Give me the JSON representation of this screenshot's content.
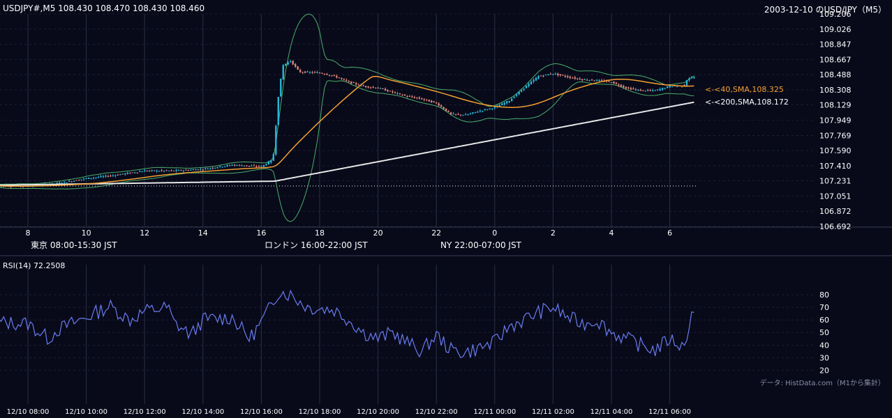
{
  "header": {
    "symbol_info": "USDJPY#,M5 108.430 108.470 108.430 108.460",
    "title": "2003-12-10 のUSD/JPY（M5）"
  },
  "sessions": [
    {
      "label": "東京 08:00-15:30 JST",
      "color": "#1f4a7a"
    },
    {
      "label": "ロンドン 16:00-22:00 JST",
      "color": "#8a5a12"
    },
    {
      "label": "NY 22:00-07:00 JST",
      "color": "#23603a"
    }
  ],
  "rsi_label": "RSI(14) 72.2508",
  "source_note": "データ: HistData.com（M1から集計）",
  "colors": {
    "background": "#080a1a",
    "candle_up": "#29b6d8",
    "candle_down": "#e0857a",
    "sma40": "#f5a030",
    "sma200": "#e8e8e8",
    "bollinger": "#4caf6a",
    "rsi": "#6a7cf0",
    "grid": "#2a2f45"
  },
  "chart_data": [
    {
      "type": "candlestick",
      "timeframe": "M5",
      "y_ticks": [
        "109.206",
        "109.026",
        "108.847",
        "108.667",
        "108.488",
        "108.308",
        "108.129",
        "107.949",
        "107.769",
        "107.590",
        "107.410",
        "107.231",
        "107.051",
        "106.872",
        "106.692"
      ],
      "ylim": [
        106.692,
        109.206
      ],
      "x_ticks": [
        "8",
        "10",
        "12",
        "14",
        "16",
        "18",
        "20",
        "22",
        "0",
        "2",
        "4",
        "6"
      ],
      "indicators": [
        {
          "name": "SMA 40",
          "label": "<-<40,SMA,108.325",
          "last": 108.325
        },
        {
          "name": "SMA 200",
          "label": "<-<200,SMA,108.172",
          "last": 108.172
        },
        {
          "name": "Bollinger Bands"
        }
      ],
      "reference_line": 107.17,
      "price_path": [
        [
          7.0,
          107.17
        ],
        [
          8.0,
          107.17
        ],
        [
          9.0,
          107.2
        ],
        [
          10.0,
          107.26
        ],
        [
          11.0,
          107.3
        ],
        [
          12.0,
          107.35
        ],
        [
          13.0,
          107.35
        ],
        [
          14.0,
          107.37
        ],
        [
          15.0,
          107.42
        ],
        [
          16.0,
          107.4
        ],
        [
          16.4,
          107.48
        ],
        [
          16.6,
          108.3
        ],
        [
          16.75,
          108.6
        ],
        [
          17.0,
          108.65
        ],
        [
          17.3,
          108.52
        ],
        [
          18.0,
          108.51
        ],
        [
          18.5,
          108.47
        ],
        [
          19.0,
          108.4
        ],
        [
          19.5,
          108.35
        ],
        [
          20.0,
          108.33
        ],
        [
          20.5,
          108.28
        ],
        [
          21.0,
          108.23
        ],
        [
          21.5,
          108.2
        ],
        [
          22.0,
          108.15
        ],
        [
          22.5,
          108.02
        ],
        [
          23.0,
          108.01
        ],
        [
          23.5,
          108.06
        ],
        [
          24.0,
          108.1
        ],
        [
          24.5,
          108.18
        ],
        [
          25.0,
          108.33
        ],
        [
          25.5,
          108.47
        ],
        [
          26.0,
          108.5
        ],
        [
          26.5,
          108.46
        ],
        [
          27.0,
          108.43
        ],
        [
          27.5,
          108.42
        ],
        [
          28.0,
          108.4
        ],
        [
          28.5,
          108.33
        ],
        [
          29.0,
          108.3
        ],
        [
          29.5,
          108.3
        ],
        [
          30.0,
          108.35
        ],
        [
          30.5,
          108.36
        ],
        [
          30.6,
          108.44
        ],
        [
          30.9,
          108.46
        ]
      ]
    },
    {
      "type": "line",
      "name": "RSI(14)",
      "y_ticks": [
        80,
        70,
        60,
        50,
        40,
        30,
        20
      ],
      "ylim": [
        18,
        90
      ],
      "x_ticks": [
        "12/10 08:00",
        "12/10 10:00",
        "12/10 12:00",
        "12/10 14:00",
        "12/10 16:00",
        "12/10 18:00",
        "12/10 20:00",
        "12/10 22:00",
        "12/11 00:00",
        "12/11 02:00",
        "12/11 04:00",
        "12/11 06:00"
      ],
      "values_path": [
        [
          7.0,
          58
        ],
        [
          8.0,
          57
        ],
        [
          8.7,
          45
        ],
        [
          9.0,
          52
        ],
        [
          10.0,
          62
        ],
        [
          10.8,
          71
        ],
        [
          11.5,
          60
        ],
        [
          12.0,
          67
        ],
        [
          12.8,
          70
        ],
        [
          13.0,
          58
        ],
        [
          13.6,
          48
        ],
        [
          14.0,
          60
        ],
        [
          15.0,
          62
        ],
        [
          15.6,
          45
        ],
        [
          16.0,
          58
        ],
        [
          16.3,
          70
        ],
        [
          16.6,
          83
        ],
        [
          17.0,
          80
        ],
        [
          17.6,
          70
        ],
        [
          18.5,
          68
        ],
        [
          19.0,
          60
        ],
        [
          19.5,
          50
        ],
        [
          20.0,
          45
        ],
        [
          20.5,
          50
        ],
        [
          21.0,
          42
        ],
        [
          21.5,
          35
        ],
        [
          22.0,
          48
        ],
        [
          22.5,
          36
        ],
        [
          23.0,
          34
        ],
        [
          23.5,
          38
        ],
        [
          24.0,
          42
        ],
        [
          24.5,
          55
        ],
        [
          25.0,
          60
        ],
        [
          25.5,
          66
        ],
        [
          26.0,
          70
        ],
        [
          26.5,
          62
        ],
        [
          27.0,
          57
        ],
        [
          27.5,
          60
        ],
        [
          28.0,
          50
        ],
        [
          28.5,
          45
        ],
        [
          29.0,
          40
        ],
        [
          29.5,
          36
        ],
        [
          30.0,
          45
        ],
        [
          30.5,
          38
        ],
        [
          30.7,
          62
        ],
        [
          30.9,
          72
        ]
      ]
    }
  ]
}
